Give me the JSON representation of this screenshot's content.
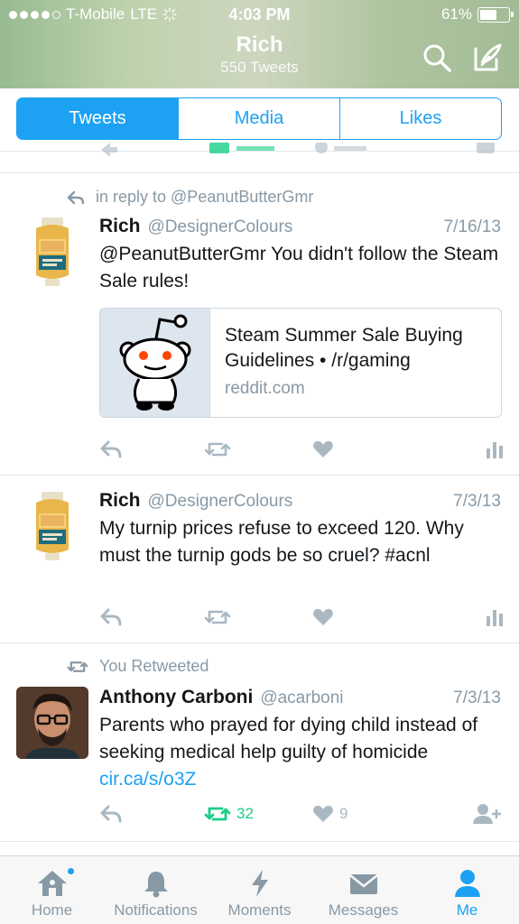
{
  "status_bar": {
    "carrier": "T-Mobile",
    "network": "LTE",
    "time": "4:03 PM",
    "battery": "61%",
    "battery_level": 0.61
  },
  "header": {
    "name": "Rich",
    "tweet_count": "550 Tweets",
    "icons": [
      "search-icon",
      "compose-icon"
    ]
  },
  "tabs": [
    {
      "label": "Tweets",
      "active": true
    },
    {
      "label": "Media",
      "active": false
    },
    {
      "label": "Likes",
      "active": false
    }
  ],
  "tweets": [
    {
      "context": "in reply to @PeanutButterGmr",
      "name": "Rich",
      "handle": "@DesignerColours",
      "date": "7/16/13",
      "text": "@PeanutButterGmr You didn't follow the Steam Sale rules!",
      "card": {
        "title": "Steam Summer Sale Buying Guidelines • /r/gaming",
        "domain": "reddit.com"
      }
    },
    {
      "name": "Rich",
      "handle": "@DesignerColours",
      "date": "7/3/13",
      "text": "My turnip prices refuse to exceed 120. Why must the turnip gods be so cruel? #acnl"
    },
    {
      "context": "You Retweeted",
      "name": "Anthony Carboni",
      "handle": "@acarboni",
      "date": "7/3/13",
      "text": "Parents who prayed for dying child instead of seeking medical help guilty of homicide ",
      "link": "cir.ca/s/o3Z",
      "retweets": "32",
      "likes": "9"
    }
  ],
  "colors": {
    "accent": "#1da1f2",
    "retweet_green": "#19cf86",
    "muted": "#8899a6"
  },
  "bottom_nav": [
    {
      "label": "Home",
      "icon": "home-icon"
    },
    {
      "label": "Notifications",
      "icon": "bell-icon"
    },
    {
      "label": "Moments",
      "icon": "lightning-icon"
    },
    {
      "label": "Messages",
      "icon": "envelope-icon"
    },
    {
      "label": "Me",
      "icon": "person-icon",
      "active": true
    }
  ]
}
